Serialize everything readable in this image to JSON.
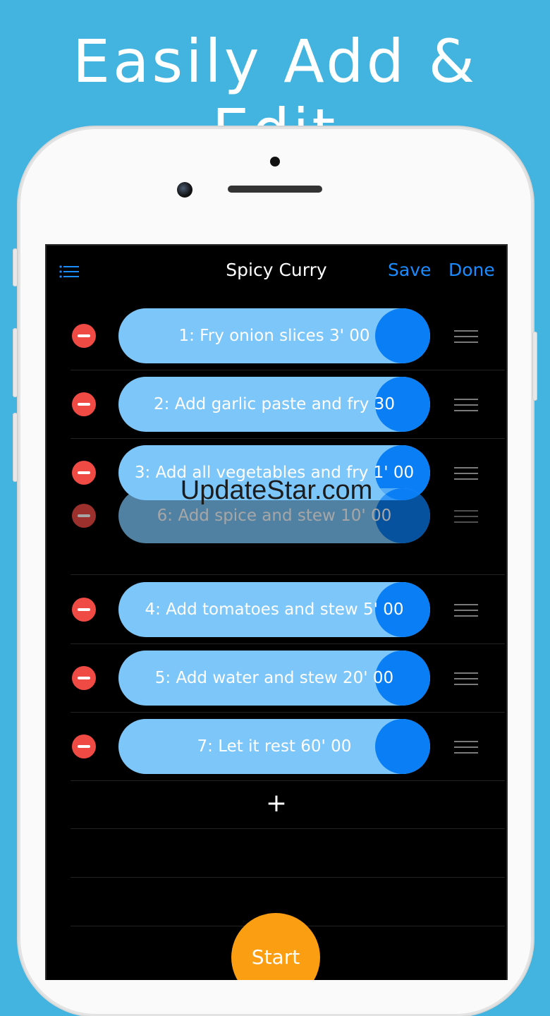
{
  "headline": "Easily Add & Edit",
  "nav": {
    "menu_icon": "list-icon",
    "title": "Spicy Curry",
    "save_label": "Save",
    "done_label": "Done"
  },
  "steps": [
    {
      "label": "1:  Fry onion slices  3' 00"
    },
    {
      "label": "2:  Add garlic paste and fry  30"
    },
    {
      "label": "3:  Add all vegetables and fry  1' 00"
    },
    {
      "label": "6:  Add spice and stew  10' 00"
    },
    {
      "label": "4:  Add tomatoes and stew  5' 00"
    },
    {
      "label": "5:  Add water and stew  20' 00"
    },
    {
      "label": "7:  Let it rest  60' 00"
    }
  ],
  "watermark": "UpdateStar.com",
  "add_label": "+",
  "start_label": "Start",
  "colors": {
    "background": "#43B4DF",
    "accent": "#1A8CFF",
    "pill": "#7DC6F9",
    "knob": "#0A7FF5",
    "delete": "#F04A45",
    "start": "#FB9E12"
  }
}
